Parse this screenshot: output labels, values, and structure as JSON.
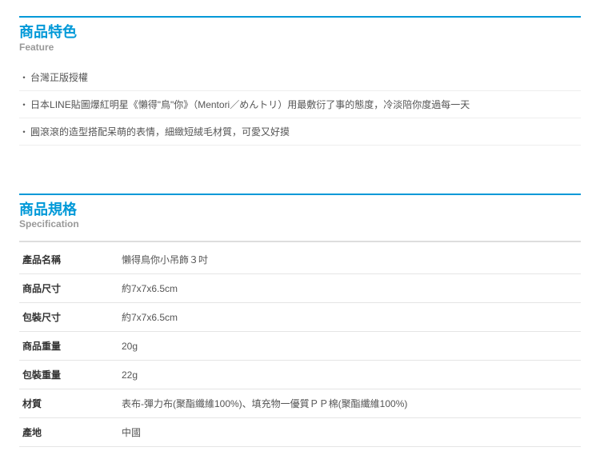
{
  "feature_section": {
    "title": "商品特色",
    "subtitle": "Feature",
    "items": [
      "台灣正版授權",
      "日本LINE貼圖爆紅明星《懶得\"鳥\"你》（Mentori／めんトリ）用最敷衍了事的態度，冷淡陪你度過每一天",
      "圓滾滾的造型搭配呆萌的表情，細緻短絨毛材質，可愛又好摸"
    ]
  },
  "spec_section": {
    "title": "商品規格",
    "subtitle": "Specification",
    "rows": [
      {
        "label": "產品名稱",
        "value": "懶得鳥你小吊飾３吋"
      },
      {
        "label": "商品尺寸",
        "value": "約7x7x6.5cm"
      },
      {
        "label": "包裝尺寸",
        "value": "約7x7x6.5cm"
      },
      {
        "label": "商品重量",
        "value": "20g"
      },
      {
        "label": "包裝重量",
        "value": "22g"
      },
      {
        "label": "材質",
        "value": "表布-彈力布(聚酯纖維100%)、填充物一優質ＰＰ棉(聚酯纖維100%)"
      },
      {
        "label": "產地",
        "value": "中國"
      }
    ]
  }
}
